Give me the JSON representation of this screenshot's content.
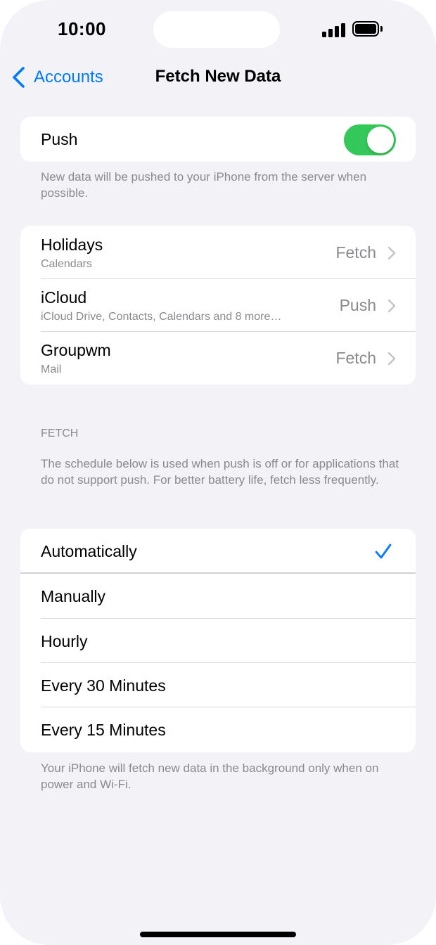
{
  "status_bar": {
    "time": "10:00"
  },
  "nav": {
    "back_label": "Accounts",
    "title": "Fetch New Data"
  },
  "push": {
    "label": "Push",
    "enabled": true,
    "footer": "New data will be pushed to your iPhone from the server when possible."
  },
  "accounts": [
    {
      "name": "Holidays",
      "detail": "Calendars",
      "value": "Fetch"
    },
    {
      "name": "iCloud",
      "detail": "iCloud Drive, Contacts, Calendars and 8 more…",
      "value": "Push"
    },
    {
      "name": "Groupwm",
      "detail": "Mail",
      "value": "Fetch"
    }
  ],
  "fetch": {
    "header": "FETCH",
    "description": "The schedule below is used when push is off or for applications that do not support push. For better battery life, fetch less frequently.",
    "options": [
      "Automatically",
      "Manually",
      "Hourly",
      "Every 30 Minutes",
      "Every 15 Minutes"
    ],
    "selected": "Automatically",
    "footer": "Your iPhone will fetch new data in the background only when on power and Wi-Fi."
  },
  "colors": {
    "accent": "#007aff",
    "toggle_on": "#34c759",
    "background": "#f2f2f7",
    "secondary_text": "#8a8a8e"
  },
  "icons": {
    "back": "chevron-left-icon",
    "disclosure": "chevron-right-icon",
    "selected": "checkmark-icon",
    "signal": "cellular-signal-icon",
    "battery": "battery-icon"
  }
}
